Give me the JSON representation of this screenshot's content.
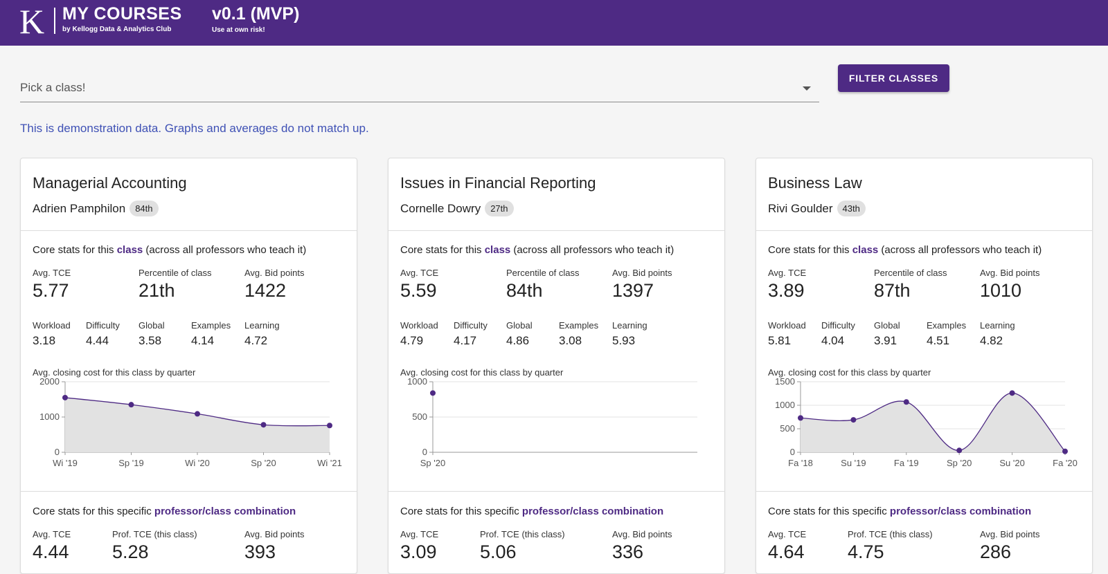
{
  "header": {
    "logo_letter": "K",
    "title": "MY COURSES",
    "subtitle": "by Kellogg Data & Analytics Club",
    "version": "v0.1 (MVP)",
    "version_note": "Use at own risk!",
    "bar_color": "#4e2a84"
  },
  "picker": {
    "placeholder": "Pick a class!",
    "icon": "chevron-down-icon"
  },
  "filter_button": "FILTER CLASSES",
  "notice": "This is demonstration data. Graphs and averages do not match up.",
  "accent_color": "#4e2a84",
  "cards": [
    {
      "course": "Managerial Accounting",
      "professor": "Adrien Pamphilon",
      "rank": "84th",
      "class_stats_pre": "Core stats for this ",
      "class_stats_hl": "class",
      "class_stats_post": " (across all professors who teach it)",
      "avg_tce_label": "Avg. TCE",
      "avg_tce": "5.77",
      "percentile_label": "Percentile of class",
      "percentile": "21th",
      "bid_label": "Avg. Bid points",
      "bid": "1422",
      "workload_label": "Workload",
      "workload": "3.18",
      "difficulty_label": "Difficulty",
      "difficulty": "4.44",
      "global_label": "Global",
      "global": "3.58",
      "examples_label": "Examples",
      "examples": "4.14",
      "learning_label": "Learning",
      "learning": "4.72",
      "chart_title": "Avg. closing cost for this class by quarter",
      "combo_pre": "Core stats for this specific ",
      "combo_hl": "professor/class combination",
      "combo_tce_label": "Avg. TCE",
      "combo_tce": "4.44",
      "combo_prof_label": "Prof. TCE (this class)",
      "combo_prof": "5.28",
      "combo_bid_label": "Avg. Bid points",
      "combo_bid": "393"
    },
    {
      "course": "Issues in Financial Reporting",
      "professor": "Cornelle Dowry",
      "rank": "27th",
      "class_stats_pre": "Core stats for this ",
      "class_stats_hl": "class",
      "class_stats_post": " (across all professors who teach it)",
      "avg_tce_label": "Avg. TCE",
      "avg_tce": "5.59",
      "percentile_label": "Percentile of class",
      "percentile": "84th",
      "bid_label": "Avg. Bid points",
      "bid": "1397",
      "workload_label": "Workload",
      "workload": "4.79",
      "difficulty_label": "Difficulty",
      "difficulty": "4.17",
      "global_label": "Global",
      "global": "4.86",
      "examples_label": "Examples",
      "examples": "3.08",
      "learning_label": "Learning",
      "learning": "5.93",
      "chart_title": "Avg. closing cost for this class by quarter",
      "combo_pre": "Core stats for this specific ",
      "combo_hl": "professor/class combination",
      "combo_tce_label": "Avg. TCE",
      "combo_tce": "3.09",
      "combo_prof_label": "Prof. TCE (this class)",
      "combo_prof": "5.06",
      "combo_bid_label": "Avg. Bid points",
      "combo_bid": "336"
    },
    {
      "course": "Business Law",
      "professor": "Rivi Goulder",
      "rank": "43th",
      "class_stats_pre": "Core stats for this ",
      "class_stats_hl": "class",
      "class_stats_post": " (across all professors who teach it)",
      "avg_tce_label": "Avg. TCE",
      "avg_tce": "3.89",
      "percentile_label": "Percentile of class",
      "percentile": "87th",
      "bid_label": "Avg. Bid points",
      "bid": "1010",
      "workload_label": "Workload",
      "workload": "5.81",
      "difficulty_label": "Difficulty",
      "difficulty": "4.04",
      "global_label": "Global",
      "global": "3.91",
      "examples_label": "Examples",
      "examples": "4.51",
      "learning_label": "Learning",
      "learning": "4.82",
      "chart_title": "Avg. closing cost for this class by quarter",
      "combo_pre": "Core stats for this specific ",
      "combo_hl": "professor/class combination",
      "combo_tce_label": "Avg. TCE",
      "combo_tce": "4.64",
      "combo_prof_label": "Prof. TCE (this class)",
      "combo_prof": "4.75",
      "combo_bid_label": "Avg. Bid points",
      "combo_bid": "286"
    }
  ],
  "chart_data": [
    {
      "type": "area",
      "categories": [
        "Wi '19",
        "Sp '19",
        "Wi '20",
        "Sp '20",
        "Wi '21"
      ],
      "values": [
        1550,
        1350,
        1090,
        780,
        760
      ],
      "ylim": [
        0,
        2000
      ],
      "yticks": [
        0,
        1000,
        2000
      ],
      "grid": true,
      "color": "#4e2a84"
    },
    {
      "type": "scatter",
      "categories": [
        "Sp '20"
      ],
      "values": [
        840
      ],
      "ylim": [
        0,
        1000
      ],
      "yticks": [
        0,
        500,
        1000
      ],
      "grid": true,
      "color": "#4e2a84"
    },
    {
      "type": "area",
      "categories": [
        "Fa '18",
        "Su '19",
        "Fa '19",
        "Sp '20",
        "Su '20",
        "Fa '20"
      ],
      "values": [
        730,
        690,
        1070,
        40,
        1260,
        20
      ],
      "ylim": [
        0,
        1500
      ],
      "yticks": [
        0,
        500,
        1000,
        1500
      ],
      "grid": true,
      "color": "#4e2a84"
    }
  ]
}
